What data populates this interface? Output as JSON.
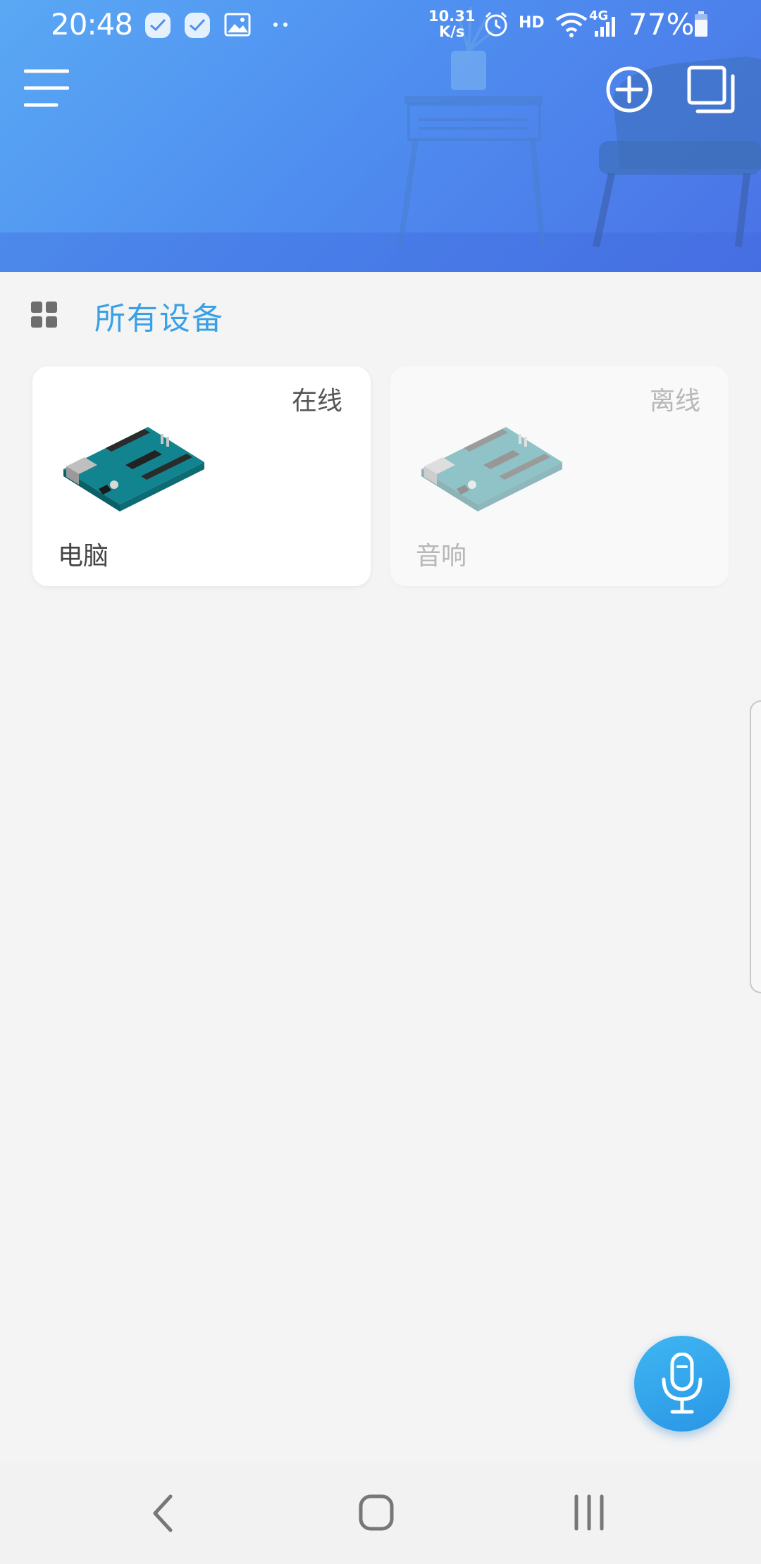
{
  "status_bar": {
    "time": "20:48",
    "net_speed_value": "10.31",
    "net_speed_unit": "K/s",
    "hd_label": "HD",
    "network_type": "4G",
    "battery_percent": "77%",
    "icons": [
      "notification-app-icon",
      "notification-app-icon",
      "image-icon",
      "more-dots-icon",
      "alarm-icon",
      "wifi-icon",
      "signal-icon",
      "battery-icon"
    ]
  },
  "header": {
    "icons": [
      "menu-icon",
      "add-circle-icon",
      "window-switch-icon"
    ],
    "colors": {
      "gradient_start": "#5aa8f4",
      "gradient_end": "#4a72e6"
    }
  },
  "section": {
    "icon": "grid-icon",
    "title": "所有设备",
    "title_color": "#3aa0e6"
  },
  "devices": [
    {
      "name": "电脑",
      "status": "在线",
      "online": true,
      "image": "arduino-board-icon"
    },
    {
      "name": "音响",
      "status": "离线",
      "online": false,
      "image": "arduino-board-icon"
    }
  ],
  "fab": {
    "icon": "microphone-icon",
    "color": "#2a96e6"
  },
  "nav_bar": {
    "icons": [
      "back-icon",
      "home-icon",
      "recents-icon"
    ]
  }
}
